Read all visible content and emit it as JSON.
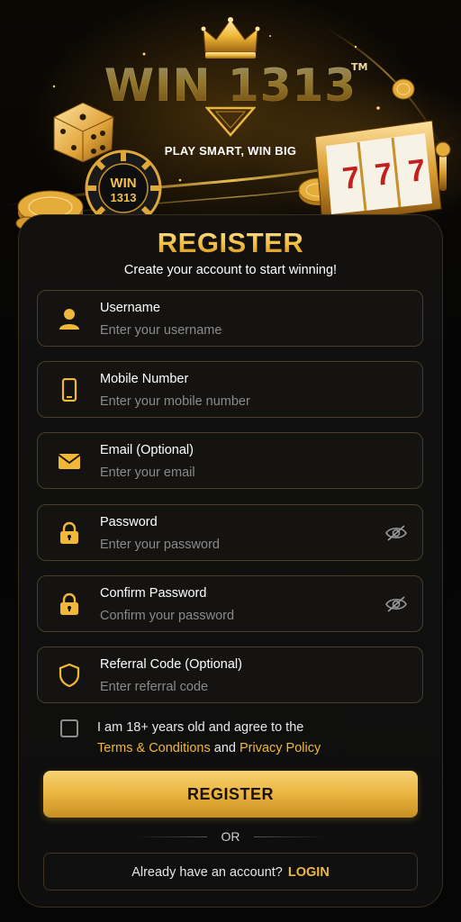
{
  "hero": {
    "brand": "WIN 1313",
    "trademark": "TM",
    "tagline": "PLAY SMART, WIN BIG",
    "chip_label_top": "WIN",
    "chip_label_bottom": "1313"
  },
  "form": {
    "title": "REGISTER",
    "subtitle": "Create your account to start winning!",
    "fields": [
      {
        "label": "Username",
        "placeholder": "Enter your username",
        "icon": "user-icon"
      },
      {
        "label": "Mobile Number",
        "placeholder": "Enter your mobile number",
        "icon": "phone-icon"
      },
      {
        "label": "Email (Optional)",
        "placeholder": "Enter your email",
        "icon": "mail-icon"
      },
      {
        "label": "Password",
        "placeholder": "Enter your password",
        "icon": "lock-icon"
      },
      {
        "label": "Confirm Password",
        "placeholder": "Confirm your password",
        "icon": "lock-icon"
      },
      {
        "label": "Referral Code (Optional)",
        "placeholder": "Enter referral code",
        "icon": "shield-icon"
      }
    ],
    "agree_line1": "I am 18+ years old and agree to the",
    "terms_link": "Terms & Conditions",
    "and_text": "and",
    "privacy_link": "Privacy Policy",
    "register_button": "REGISTER",
    "or_text": "OR",
    "login_prompt": "Already have an account?",
    "login_link": "LOGIN"
  },
  "colors": {
    "accent_gold": "#f0b838",
    "background": "#050505",
    "card_border": "#3a2f18",
    "field_border": "#4a3f26"
  }
}
